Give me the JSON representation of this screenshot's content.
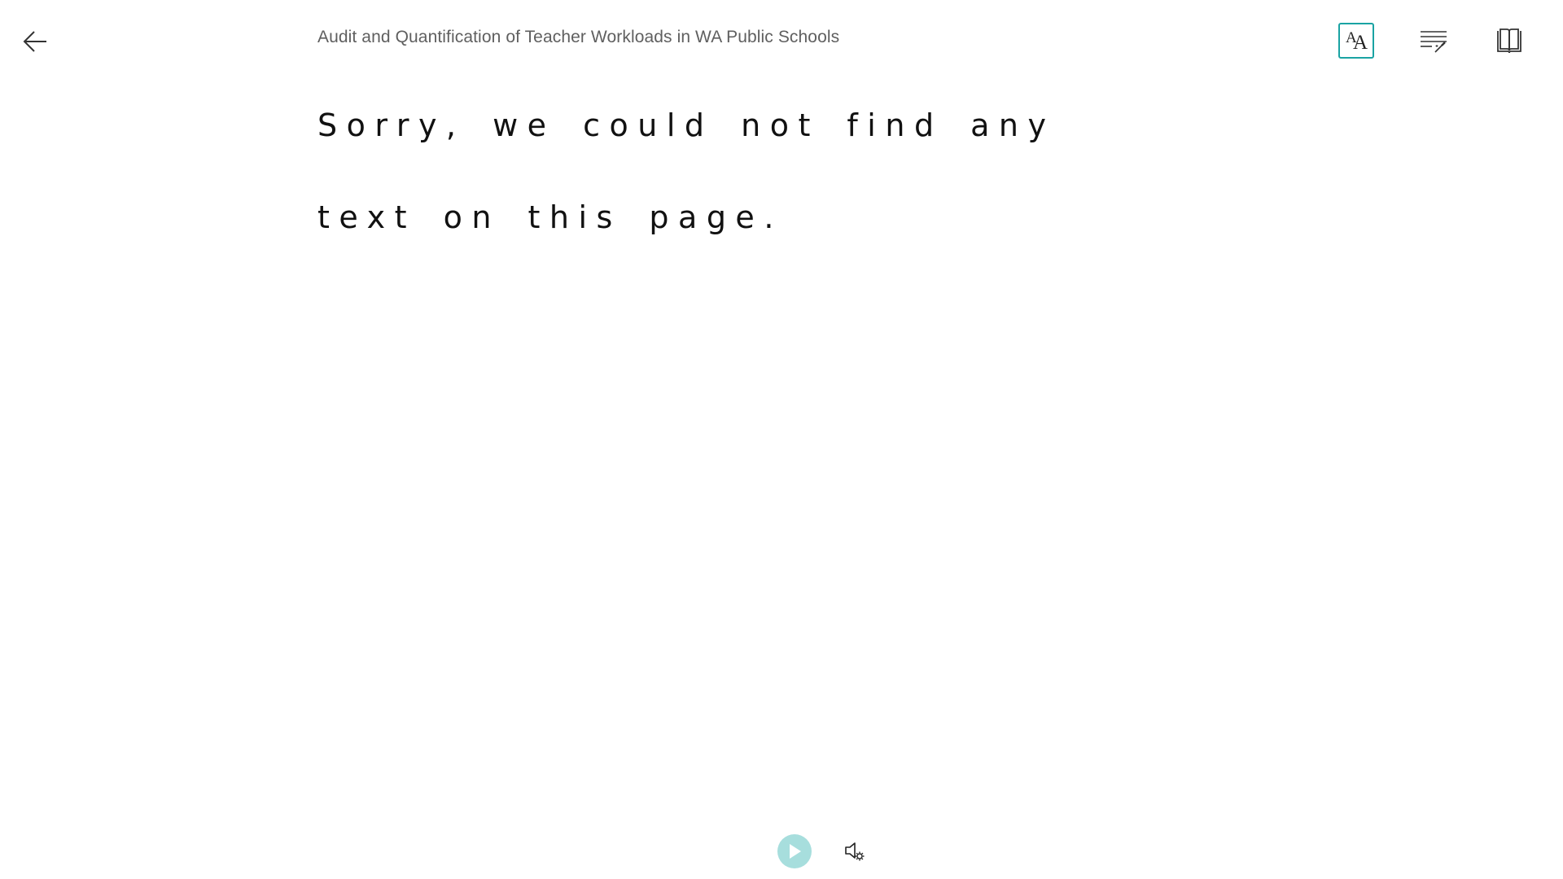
{
  "header": {
    "title": "Audit and Quantification of Teacher Workloads in WA Public Schools",
    "back_icon": "arrow-left-icon",
    "toolbar": {
      "text_preferences_icon": "text-preferences-icon",
      "text_preferences_selected": true,
      "grammar_options_icon": "grammar-options-icon",
      "reading_preferences_icon": "book-icon"
    }
  },
  "content": {
    "message": "Sorry, we could not find any text on this page."
  },
  "playback": {
    "play_icon": "play-icon",
    "voice_settings_icon": "voice-settings-icon"
  },
  "colors": {
    "accent": "#1aa3a3",
    "play_button_bg": "#a7dedd",
    "title_text": "#5f5f5f",
    "body_text": "#111111"
  }
}
